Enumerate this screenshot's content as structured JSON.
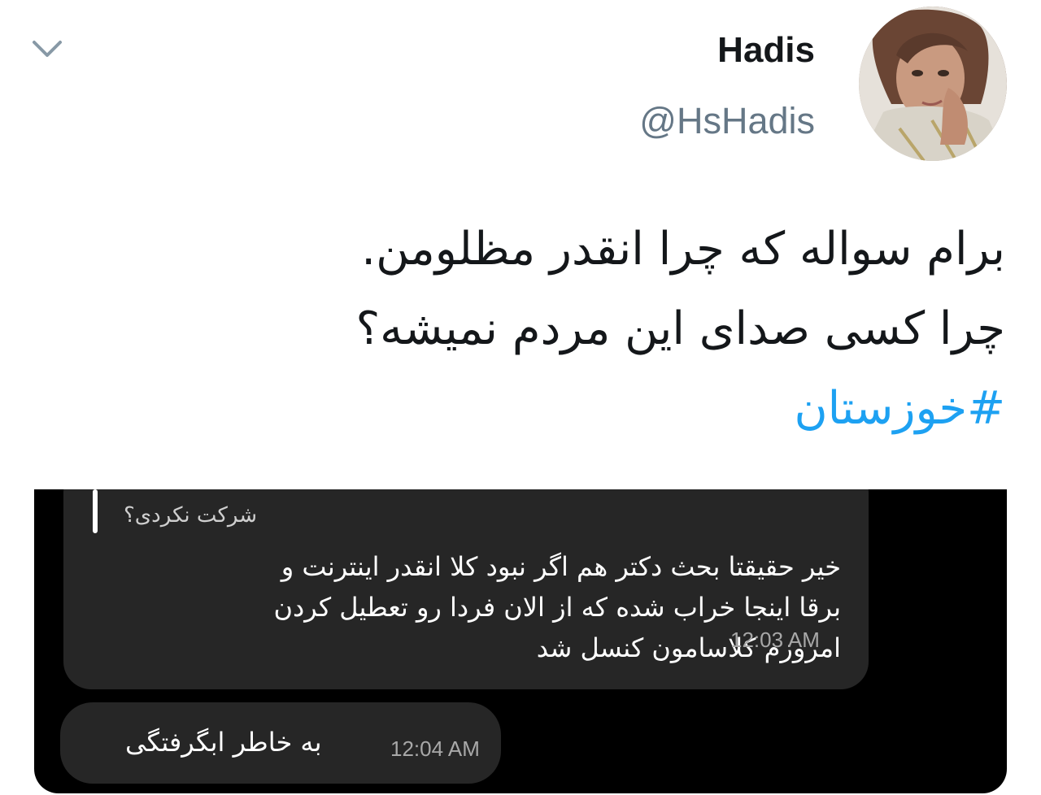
{
  "header": {
    "display_name": "Hadis",
    "handle": "@HsHadis"
  },
  "tweet": {
    "lines": [
      "برام سواله که چرا انقدر مظلومن.",
      "چرا کسی صدای این مردم نمیشه؟"
    ],
    "hashtag": "#خوزستان"
  },
  "media": {
    "quoted_text": "شرکت نکردی؟",
    "message_1": {
      "lines": [
        "خیر حقیقتا بحث دکتر هم اگر نبود کلا انقدر اینترنت و",
        "برقا اینجا خراب شده که از الان فردا رو تعطیل کردن",
        "امروزم کلاسامون کنسل شد"
      ],
      "time": "12:03 AM"
    },
    "message_2": {
      "text": "به خاطر ابگرفتگی",
      "time": "12:04 AM"
    }
  },
  "colors": {
    "hashtag": "#1da1f2",
    "handle": "#657786",
    "bubble": "#262626",
    "media_bg": "#000000"
  },
  "icons": {
    "collapse": "chevron-down-icon"
  }
}
